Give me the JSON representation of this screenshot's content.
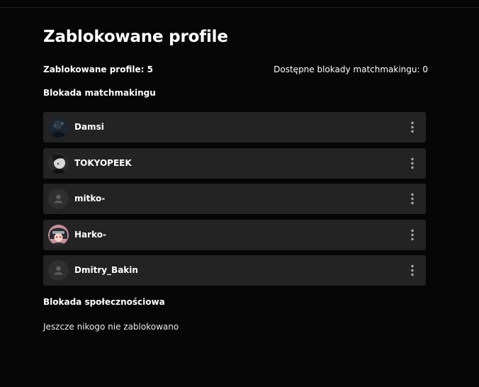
{
  "page": {
    "title": "Zablokowane profile",
    "blocked_profiles": "Zablokowane profile: 5",
    "available_blocks": "Dostępne blokady matchmakingu: 0"
  },
  "matchmaking": {
    "section_title": "Blokada matchmakingu",
    "users": [
      {
        "name": "Damsi",
        "avatar": "photo-avatar"
      },
      {
        "name": "TOKYOPEEK",
        "avatar": "photo-avatar"
      },
      {
        "name": "mitko-",
        "avatar": "default-user-icon"
      },
      {
        "name": "Harko-",
        "avatar": "photo-avatar"
      },
      {
        "name": "Dmitry_Bakin",
        "avatar": "default-user-icon"
      }
    ],
    "row_menu_icon": "more-vertical-icon"
  },
  "social": {
    "section_title": "Blokada społecznościowa",
    "empty_text": "Jeszcze nikogo nie zablokowano"
  },
  "colors": {
    "background": "#060606",
    "row": "#232323",
    "text": "#ffffff"
  }
}
